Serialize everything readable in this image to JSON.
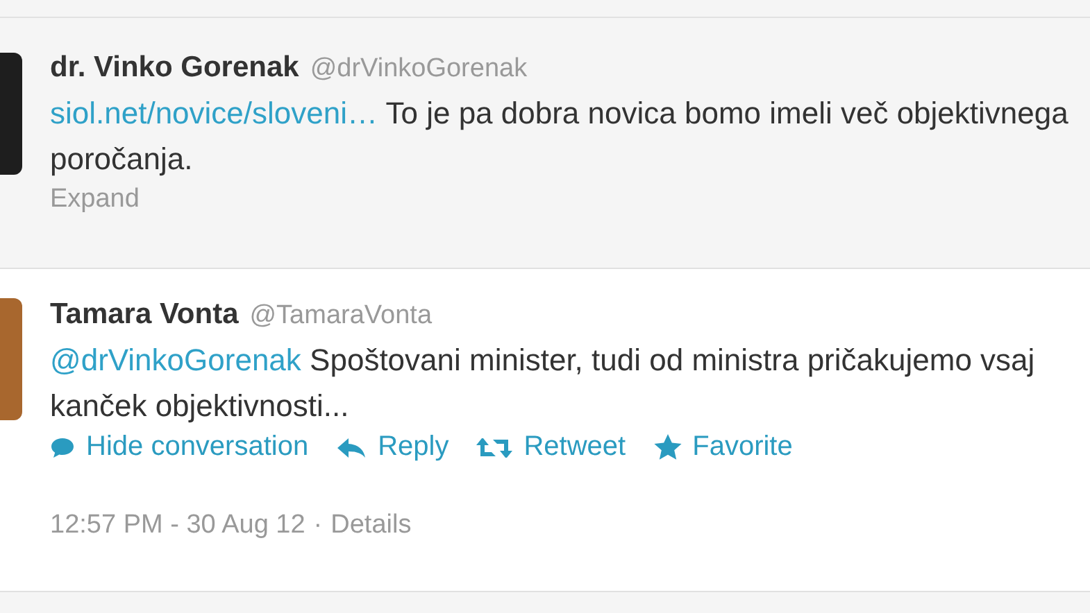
{
  "tweets": [
    {
      "name": "dr. Vinko Gorenak",
      "handle": "@drVinkoGorenak",
      "link": "siol.net/novice/sloveni…",
      "text": "To je pa dobra novica bomo imeli več objektivnega poročanja.",
      "expanded": false,
      "expand_label": "Expand"
    },
    {
      "name": "Tamara Vonta",
      "handle": "@TamaraVonta",
      "link": "@drVinkoGorenak",
      "text": "Spoštovani minister, tudi od ministra pričakujemo vsaj kanček objektivnosti...",
      "expanded": true,
      "actions": [
        {
          "kind": "conversation",
          "label": "Hide conversation"
        },
        {
          "kind": "reply",
          "label": "Reply"
        },
        {
          "kind": "retweet",
          "label": "Retweet"
        },
        {
          "kind": "favorite",
          "label": "Favorite"
        }
      ],
      "timestamp": "12:57 PM - 30 Aug 12",
      "separator": "·",
      "details": "Details"
    }
  ]
}
